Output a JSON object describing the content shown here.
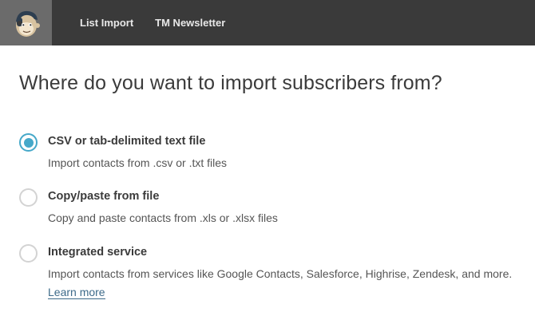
{
  "nav": {
    "logo_icon": "freddie-chimp-logo-icon",
    "links": [
      "List Import",
      "TM Newsletter"
    ]
  },
  "heading": "Where do you want to import subscribers from?",
  "options": [
    {
      "title": "CSV or tab-delimited text file",
      "description": "Import contacts from .csv or .txt files",
      "selected": true
    },
    {
      "title": "Copy/paste from file",
      "description": "Copy and paste contacts from .xls or .xlsx files",
      "selected": false
    },
    {
      "title": "Integrated service",
      "description": "Import contacts from services like Google Contacts, Salesforce, Highrise, Zendesk, and more.",
      "link_label": "Learn more",
      "selected": false
    }
  ],
  "colors": {
    "topbar": "#3a3a3a",
    "logo_bg": "#6b6b6b",
    "accent": "#45a8c9",
    "link": "#3e6b8a"
  }
}
